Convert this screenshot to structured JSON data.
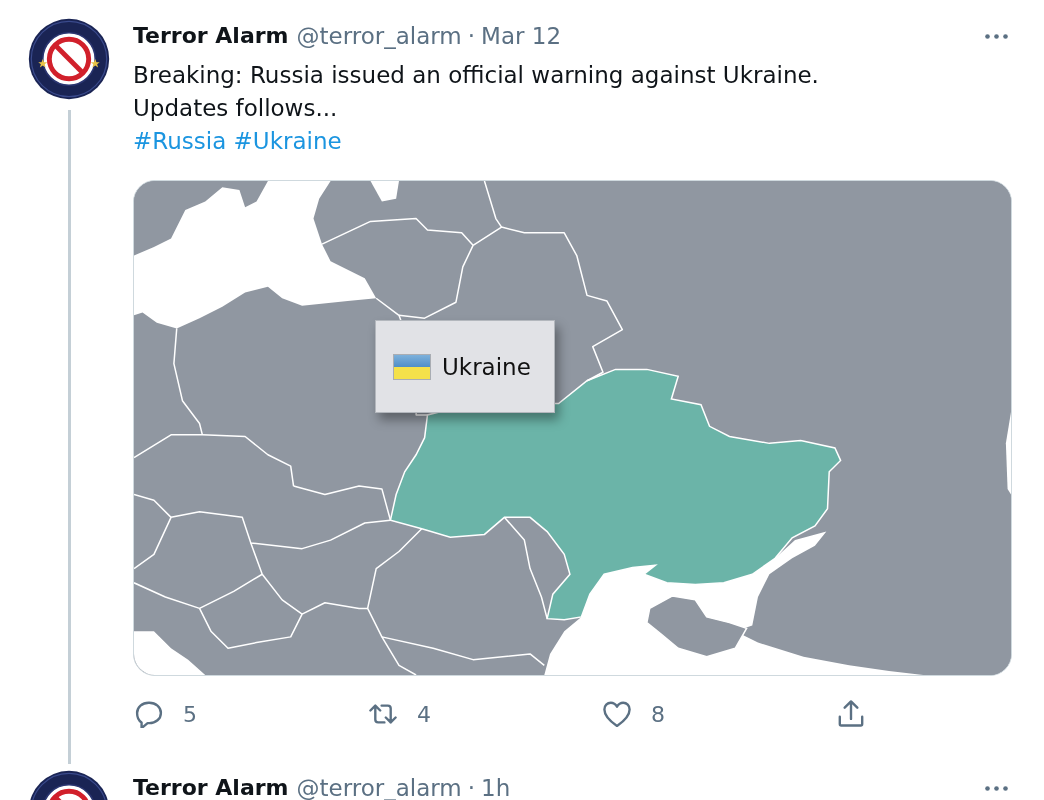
{
  "tweets": [
    {
      "author": {
        "name": "Terror Alarm",
        "handle": "@terror_alarm"
      },
      "separator": "·",
      "time": "Mar 12",
      "text": [
        "Breaking: Russia issued an official warning against Ukraine.",
        "Updates follows..."
      ],
      "hashtags": [
        "#Russia",
        "#Ukraine"
      ],
      "media": {
        "kind": "map",
        "tooltip": "Ukraine"
      },
      "actions": [
        {
          "kind": "reply",
          "count": "5"
        },
        {
          "kind": "retweet",
          "count": "4"
        },
        {
          "kind": "like",
          "count": "8"
        },
        {
          "kind": "share"
        }
      ]
    },
    {
      "author": {
        "name": "Terror Alarm",
        "handle": "@terror_alarm"
      },
      "separator": "·",
      "time": "1h"
    }
  ]
}
